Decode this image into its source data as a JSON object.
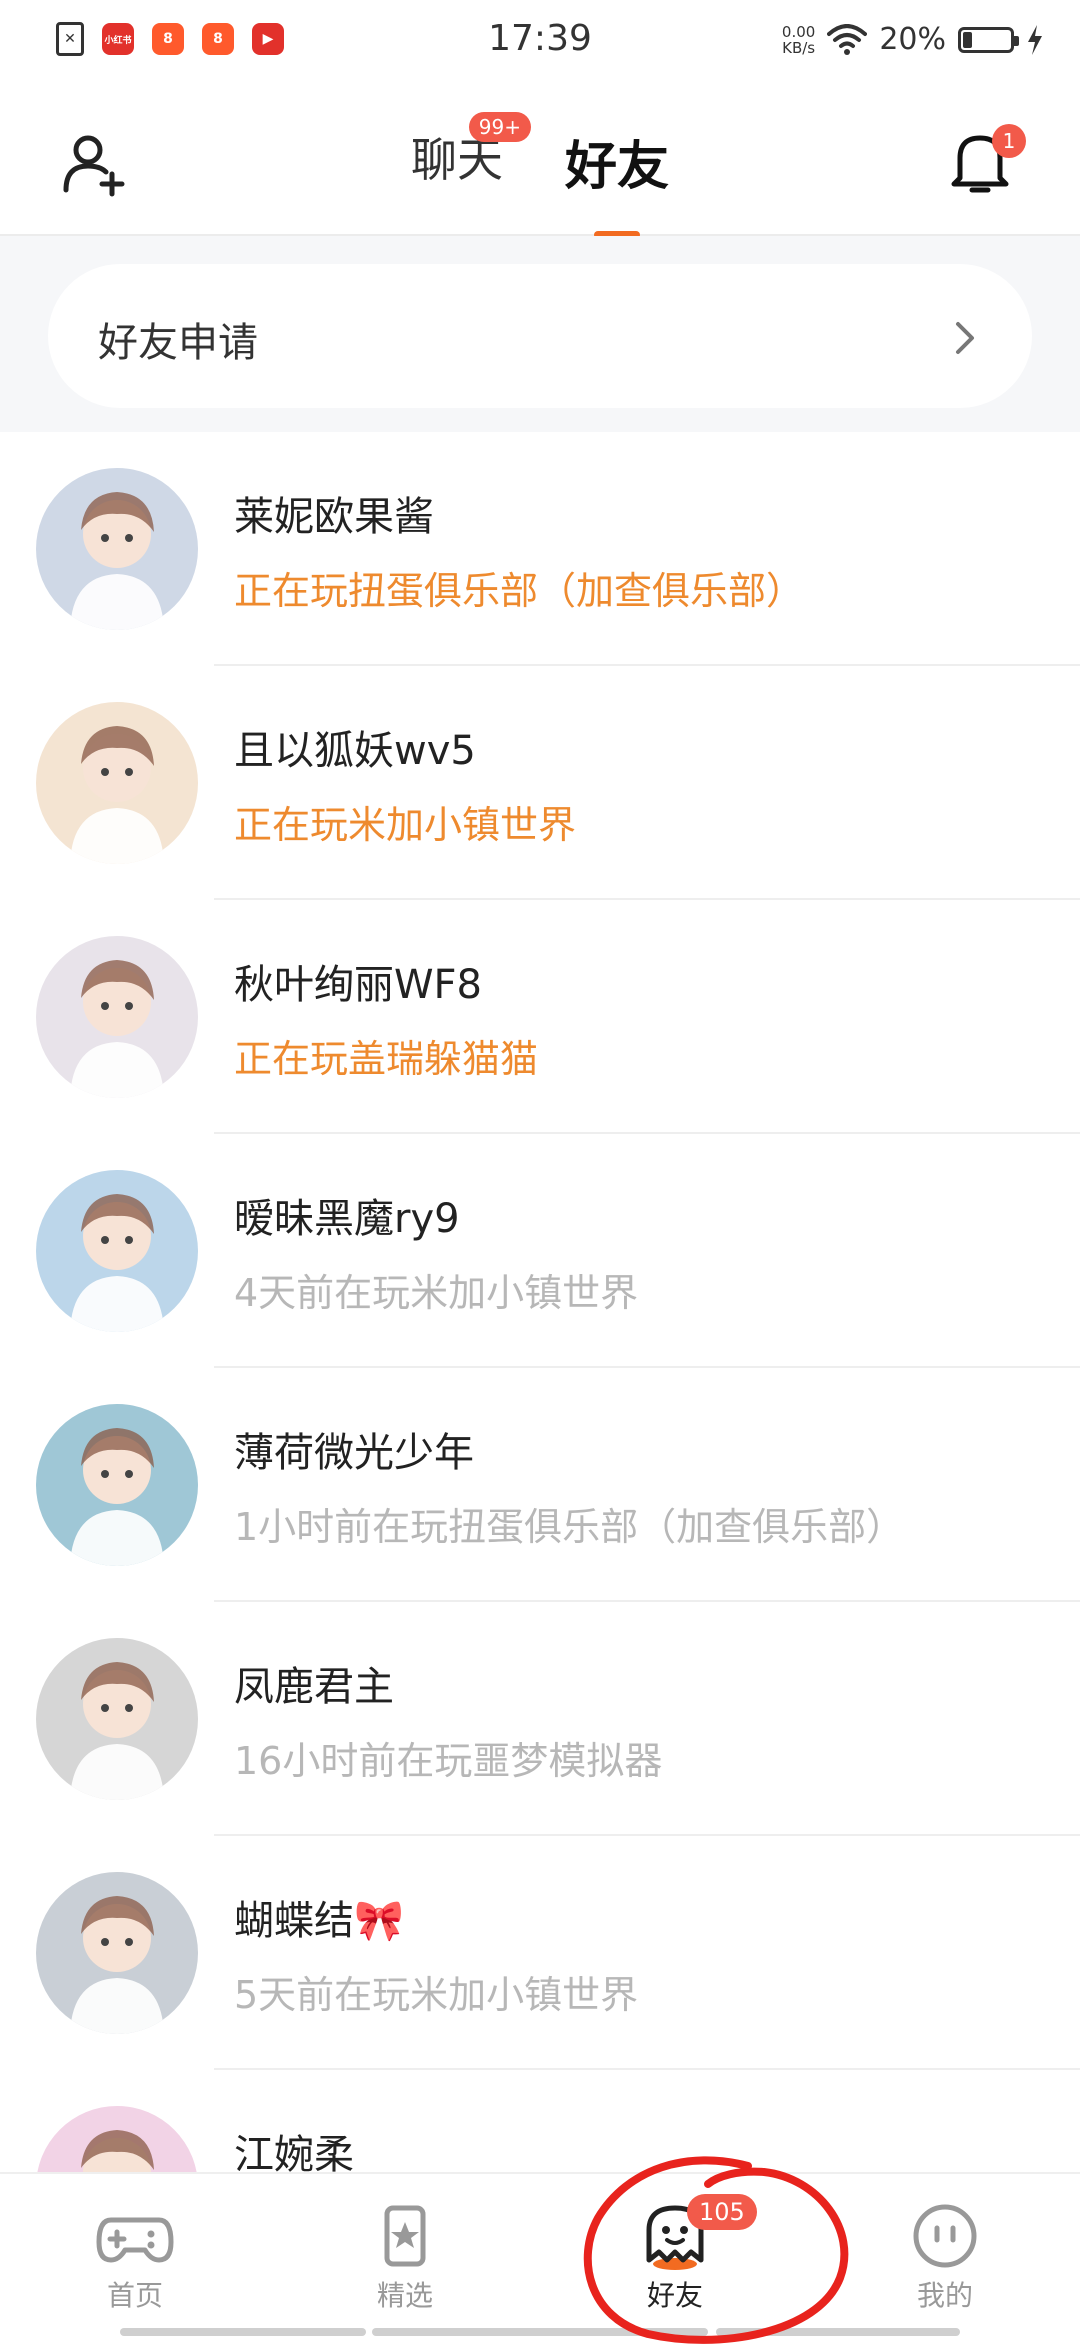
{
  "status_bar": {
    "time": "17:39",
    "net_speed_value": "0.00",
    "net_speed_unit": "KB/s",
    "battery_percent": "20%",
    "battery_level": 0.2,
    "app_icon_text": "小红书"
  },
  "header": {
    "tabs": [
      {
        "label": "聊天",
        "badge": "99+"
      },
      {
        "label": "好友"
      }
    ],
    "notification_badge": "1"
  },
  "friend_request": {
    "label": "好友申请"
  },
  "friends": [
    {
      "name": "莱妮欧果酱",
      "status": "正在玩扭蛋俱乐部（加查俱乐部）",
      "live": true,
      "avatar_color": "#cfd8e6"
    },
    {
      "name": "且以狐妖wv5",
      "status": "正在玩米加小镇世界",
      "live": true,
      "avatar_color": "#f4e4d2"
    },
    {
      "name": "秋叶绚丽WF8",
      "status": "正在玩盖瑞躲猫猫",
      "live": true,
      "avatar_color": "#e8e3ea"
    },
    {
      "name": "暧昧黑魔ry9",
      "status": "4天前在玩米加小镇世界",
      "live": false,
      "avatar_color": "#bcd6ea"
    },
    {
      "name": "薄荷微光少年",
      "status": "1小时前在玩扭蛋俱乐部（加查俱乐部）",
      "live": false,
      "avatar_color": "#9fc7d6"
    },
    {
      "name": "凤鹿君主",
      "status": "16小时前在玩噩梦模拟器",
      "live": false,
      "avatar_color": "#d6d6d6"
    },
    {
      "name": "蝴蝶结🎀",
      "status": "5天前在玩米加小镇世界",
      "live": false,
      "avatar_color": "#c9cfd6"
    },
    {
      "name": "江婉柔",
      "status": "",
      "live": false,
      "avatar_color": "#f2d3e6"
    }
  ],
  "bottom_nav": [
    {
      "label": "首页"
    },
    {
      "label": "精选"
    },
    {
      "label": "好友",
      "badge": "105"
    },
    {
      "label": "我的"
    }
  ],
  "colors": {
    "accent": "#f26b21",
    "live_status": "#ee8a2e",
    "past_status": "#b7b7b7",
    "badge": "#f25a4a",
    "annotation": "#e8231d"
  }
}
